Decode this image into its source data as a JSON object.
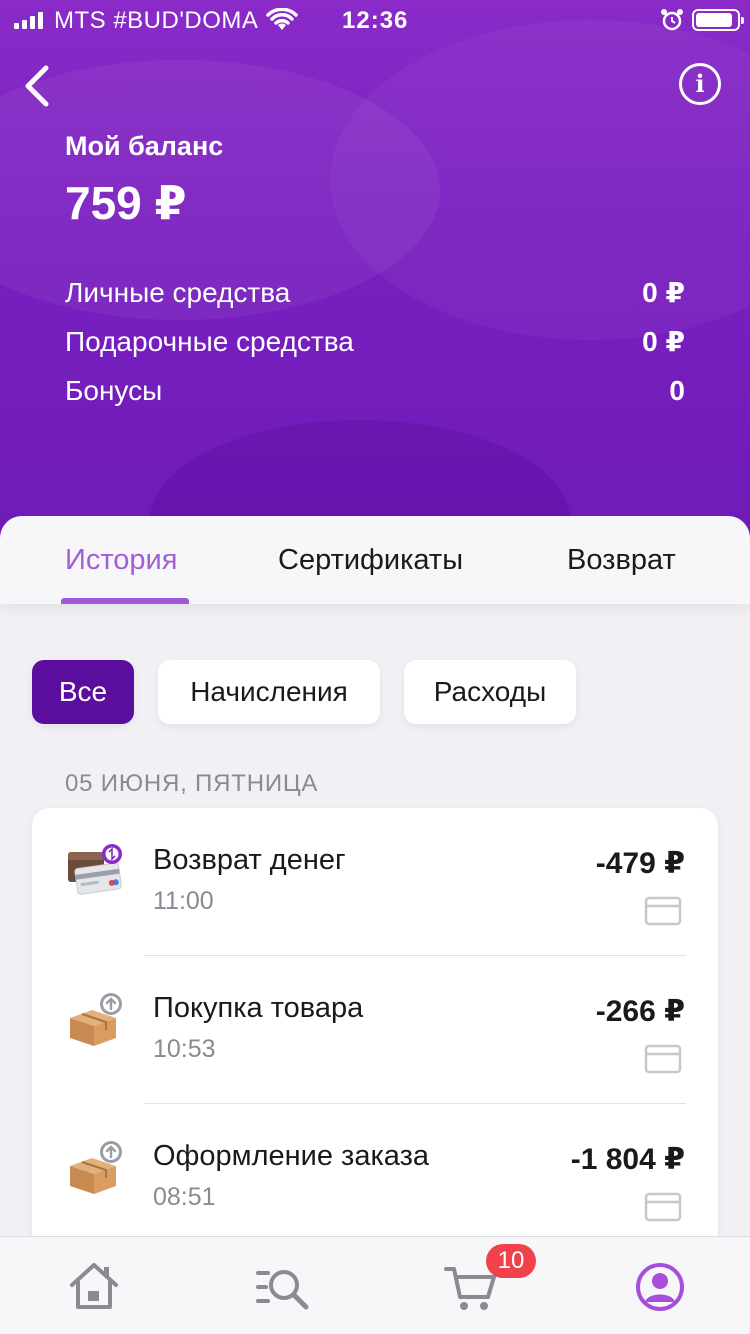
{
  "status_bar": {
    "carrier": "MTS #BUD'DOMA",
    "time": "12:36"
  },
  "header": {
    "title": "Мой баланс",
    "balance": "759 ₽",
    "breakdown": [
      {
        "label": "Личные средства",
        "value": "0 ₽"
      },
      {
        "label": "Подарочные средства",
        "value": "0 ₽"
      },
      {
        "label": "Бонусы",
        "value": "0"
      }
    ]
  },
  "tabs": [
    {
      "label": "История",
      "active": true
    },
    {
      "label": "Сертификаты",
      "active": false
    },
    {
      "label": "Возврат",
      "active": false
    }
  ],
  "filters": [
    {
      "label": "Все",
      "active": true
    },
    {
      "label": "Начисления",
      "active": false
    },
    {
      "label": "Расходы",
      "active": false
    }
  ],
  "history": {
    "date": "05 ИЮНЯ, ПЯТНИЦА",
    "transactions": [
      {
        "title": "Возврат денег",
        "time": "11:00",
        "amount": "-479 ₽",
        "icon": "refund-wallet-icon"
      },
      {
        "title": "Покупка товара",
        "time": "10:53",
        "amount": "-266 ₽",
        "icon": "package-upload-icon"
      },
      {
        "title": "Оформление заказа",
        "time": "08:51",
        "amount": "-1 804 ₽",
        "icon": "package-upload-icon"
      }
    ]
  },
  "bottom_nav": {
    "cart_badge": "10",
    "items": [
      "home-icon",
      "catalog-search-icon",
      "cart-icon",
      "profile-icon"
    ]
  },
  "colors": {
    "header_gradient_top": "#8a2bc8",
    "header_gradient_bottom": "#6d1bb8",
    "active_tab": "#a15fd6",
    "active_chip": "#5b0d9d",
    "badge": "#f1424b"
  }
}
